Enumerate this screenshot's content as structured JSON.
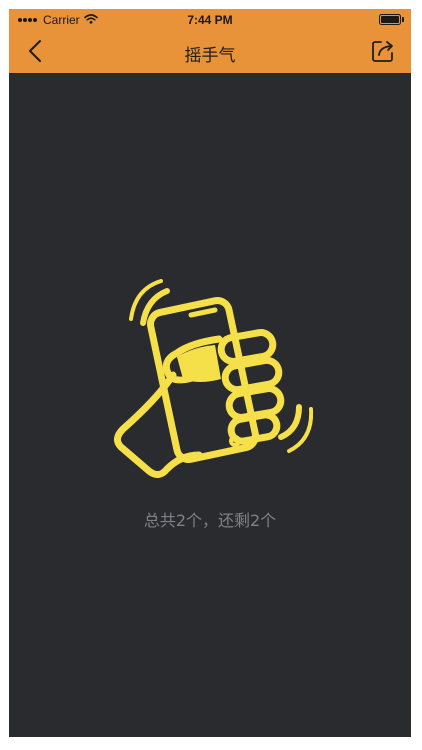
{
  "status_bar": {
    "carrier": "Carrier",
    "time": "7:44 PM",
    "battery_level": 1.0
  },
  "nav": {
    "title": "摇手气",
    "back_icon": "chevron-left-icon",
    "share_icon": "share-icon"
  },
  "main": {
    "illustration": "shake-phone-hand-icon",
    "count_text": "总共2个，还剩2个"
  },
  "colors": {
    "header": "#e8923a",
    "background": "#2a2b2e",
    "accent": "#f5e04a",
    "muted_text": "#7f8186"
  }
}
